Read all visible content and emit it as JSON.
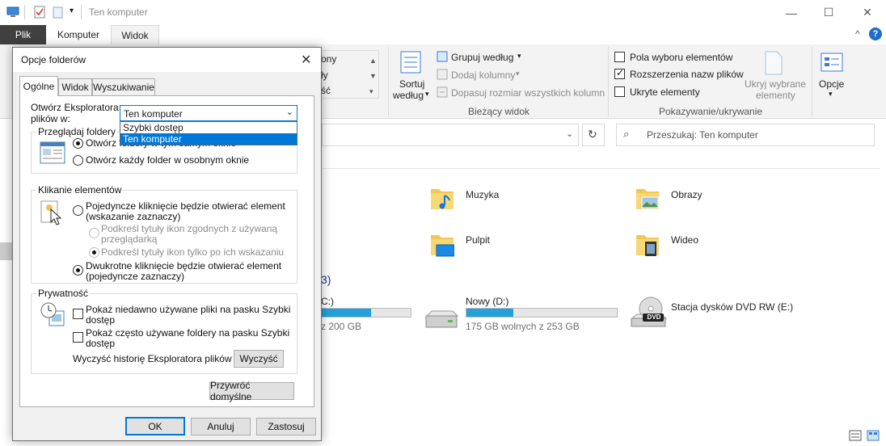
{
  "window": {
    "title": "Ten komputer",
    "controls": {
      "minimize": "—",
      "maximize": "☐",
      "close": "✕"
    }
  },
  "ribbon": {
    "tabs": [
      {
        "label": "Plik"
      },
      {
        "label": "Komputer"
      },
      {
        "label": "Widok"
      }
    ],
    "partial_items": {
      "item1": "ony",
      "item2": "ły",
      "item3": "ść"
    },
    "sort_label": "Sortuj",
    "sort_label2": "według",
    "group_by": "Grupuj według",
    "add_columns": "Dodaj kolumny",
    "fit_columns": "Dopasuj rozmiar wszystkich kolumn",
    "current_view_group": "Bieżący widok",
    "check_item_checkboxes": {
      "label": "Pola wyboru elementów",
      "checked": false
    },
    "check_file_extensions": {
      "label": "Rozszerzenia nazw plików",
      "checked": true
    },
    "check_hidden_items": {
      "label": "Ukryte elementy",
      "checked": false
    },
    "hide_selected": "Ukryj wybrane",
    "hide_selected2": "elementy",
    "options": "Opcje",
    "show_hide_group": "Pokazywanie/ukrywanie"
  },
  "search": {
    "placeholder": "Przeszukaj: Ten komputer"
  },
  "folders": [
    {
      "name": "Muzyka"
    },
    {
      "name": "Obrazy"
    },
    {
      "name": "Pulpit"
    },
    {
      "name": "Wideo"
    }
  ],
  "devices_header": "3)",
  "drives": [
    {
      "name": "C:)",
      "free": "z 200 GB",
      "fill": 0.55
    },
    {
      "name": "Nowy (D:)",
      "free": "175 GB wolnych z 253 GB",
      "fill": 0.31
    },
    {
      "name": "Stacja dysków DVD RW (E:)",
      "badge": "DVD"
    }
  ],
  "dialog": {
    "title": "Opcje folderów",
    "tabs": [
      {
        "label": "Ogólne"
      },
      {
        "label": "Widok"
      },
      {
        "label": "Wyszukiwanie"
      }
    ],
    "open_explorer_label": "Otwórz Eksploratora",
    "open_explorer_label2": "plików w:",
    "combo_value": "Ten komputer",
    "dropdown_options": [
      {
        "label": "Szybki dostęp",
        "selected": false
      },
      {
        "label": "Ten komputer",
        "selected": true
      }
    ],
    "browse_group": "Przeglądaj foldery",
    "browse_same": "Otwórz foldery w tym samym oknie",
    "browse_new": "Otwórz każdy folder w osobnym oknie",
    "click_group": "Klikanie elementów",
    "single_click": "Pojedyncze kliknięcie będzie otwierać element",
    "single_click2": "(wskazanie zaznaczy)",
    "underline_consistent": "Podkreśl tytuły ikon zgodnych z używaną",
    "underline_consistent2": "przeglądarką",
    "underline_point": "Podkreśl tytuły ikon tylko po ich wskazaniu",
    "double_click": "Dwukrotne kliknięcie będzie otwierać element",
    "double_click2": "(pojedyncze zaznaczy)",
    "privacy_group": "Prywatność",
    "show_recent": "Pokaż niedawno używane pliki na pasku Szybki",
    "show_recent2": "dostęp",
    "show_frequent": "Pokaż często używane foldery na pasku Szybki",
    "show_frequent2": "dostęp",
    "clear_history_label": "Wyczyść historię Eksploratora plików",
    "clear_button": "Wyczyść",
    "restore_defaults": "Przywróć domyślne",
    "ok": "OK",
    "cancel": "Anuluj",
    "apply": "Zastosuj",
    "close": "✕"
  }
}
